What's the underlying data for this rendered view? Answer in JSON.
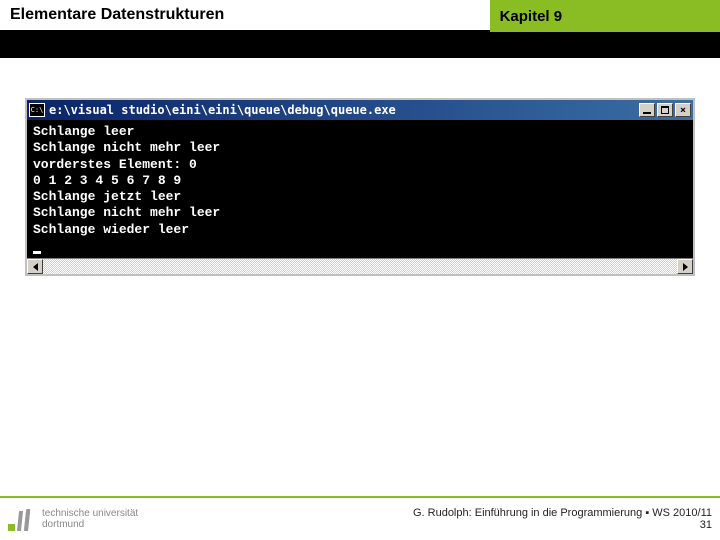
{
  "header": {
    "title": "Elementare Datenstrukturen",
    "chapter": "Kapitel 9"
  },
  "console": {
    "icon_label": "C:\\",
    "title": "e:\\visual studio\\eini\\eini\\queue\\debug\\queue.exe",
    "output": "Schlange leer\nSchlange nicht mehr leer\nvorderstes Element: 0\n0 1 2 3 4 5 6 7 8 9\nSchlange jetzt leer\nSchlange nicht mehr leer\nSchlange wieder leer",
    "buttons": {
      "min": "_",
      "max": "□",
      "close": "×"
    }
  },
  "footer": {
    "uni_line1": "technische universität",
    "uni_line2": "dortmund",
    "credit": "G. Rudolph: Einführung in die Programmierung ▪ WS 2010/11",
    "page": "31"
  }
}
